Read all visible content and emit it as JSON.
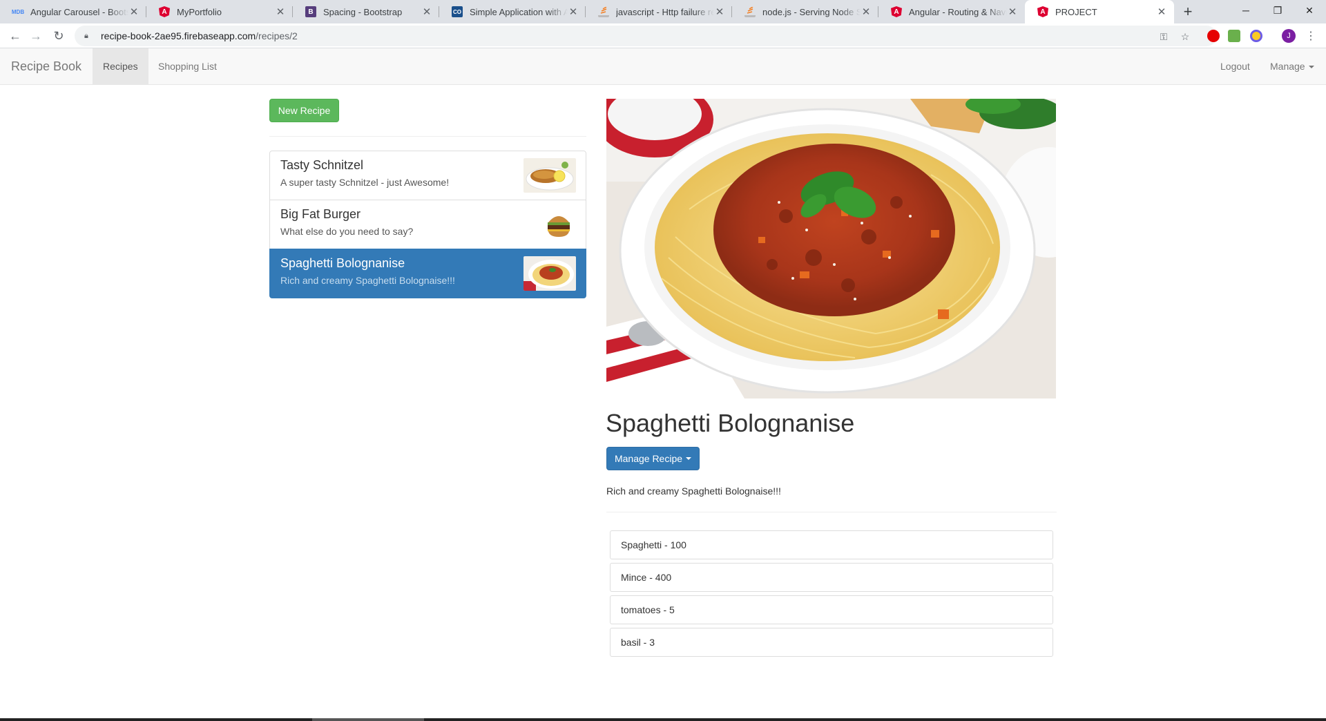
{
  "browser": {
    "tabs": [
      {
        "title": "Angular Carousel - Bootstrap",
        "icon": "mdb-icon",
        "favicon_text": "MDB",
        "color": "#4285f4"
      },
      {
        "title": "MyPortfolio",
        "icon": "angular-icon",
        "favicon_text": "A",
        "color": "#dd0031"
      },
      {
        "title": "Spacing - Bootstrap",
        "icon": "bootstrap-icon",
        "favicon_text": "B",
        "color": "#563d7c"
      },
      {
        "title": "Simple Application with Angular",
        "icon": "codeproject-icon",
        "favicon_text": "CO",
        "color": "#1a4f8b"
      },
      {
        "title": "javascript - Http failure response",
        "icon": "stackoverflow-icon",
        "favicon_text": "",
        "color": "#f48024"
      },
      {
        "title": "node.js - Serving Node Server",
        "icon": "stackoverflow-icon",
        "favicon_text": "",
        "color": "#f48024"
      },
      {
        "title": "Angular - Routing & Navigation",
        "icon": "angular-icon",
        "favicon_text": "A",
        "color": "#dd0031"
      },
      {
        "title": "PROJECT",
        "icon": "angular-icon",
        "favicon_text": "A",
        "color": "#dd0031",
        "active": true
      }
    ],
    "url_host": "recipe-book-2ae95.firebaseapp.com",
    "url_path": "/recipes/2"
  },
  "navbar": {
    "brand": "Recipe Book",
    "links": [
      {
        "label": "Recipes",
        "active": true
      },
      {
        "label": "Shopping List",
        "active": false
      }
    ],
    "logout": "Logout",
    "manage": "Manage"
  },
  "sidebar": {
    "new_recipe": "New Recipe",
    "recipes": [
      {
        "name": "Tasty Schnitzel",
        "description": "A super tasty Schnitzel - just Awesome!",
        "image": "schnitzel",
        "active": false
      },
      {
        "name": "Big Fat Burger",
        "description": "What else do you need to say?",
        "image": "burger",
        "active": false
      },
      {
        "name": "Spaghetti Bolognanise",
        "description": "Rich and creamy Spaghetti Bolognaise!!!",
        "image": "spaghetti",
        "active": true
      }
    ]
  },
  "detail": {
    "name": "Spaghetti Bolognanise",
    "manage_button": "Manage Recipe",
    "description": "Rich and creamy Spaghetti Bolognaise!!!",
    "ingredients": [
      {
        "text": "Spaghetti - 100"
      },
      {
        "text": "Mince - 400"
      },
      {
        "text": "tomatoes - 5"
      },
      {
        "text": "basil - 3"
      }
    ]
  },
  "colors": {
    "success": "#5cb85c",
    "primary": "#337ab7",
    "navbar_bg": "#f8f8f8"
  }
}
